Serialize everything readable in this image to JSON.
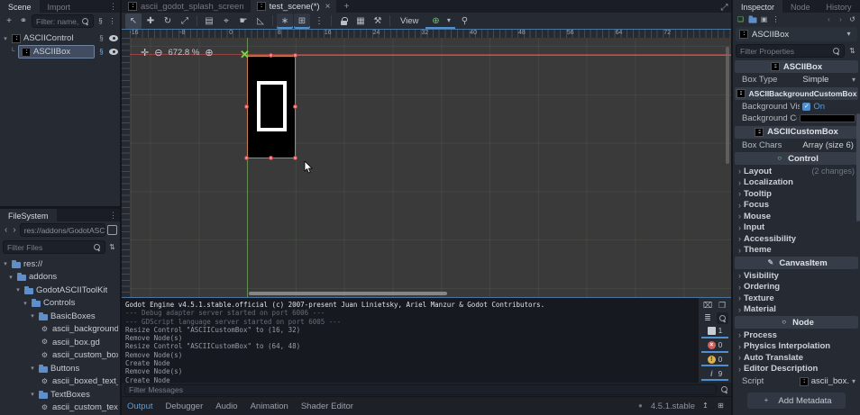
{
  "icons": {
    "plus": "+",
    "chain": "⚭",
    "kebab": "⋮",
    "check": "✓",
    "select": "↖",
    "move": "✚",
    "rotate": "↻",
    "scale": "⤢",
    "list_select": "▤",
    "pivot": "⌖",
    "pan": "☛",
    "ruler": "◺",
    "smart_snap": "∗",
    "grid_snap": "⊞",
    "group": "▦",
    "skeleton": "⚒",
    "chevron_down": "▾",
    "back": "‹",
    "fwd": "›",
    "close": "×",
    "center_view": "✛",
    "zoom_out": "⊖",
    "zoom_in": "⊕",
    "camera": "⊕",
    "mic": "⚲",
    "new_res": "❏",
    "save": "▣",
    "history": "↺",
    "sort": "⇅",
    "clear": "⌧",
    "copy": "❐",
    "collapse": "≣",
    "expand": "⤢",
    "update": "●",
    "pin": "↥",
    "float": "⊞",
    "gear": "⚙",
    "ascii_node": "::",
    "control": "○",
    "canvasitem": "✎",
    "node": "○",
    "script": "§",
    "expand_all": "᎒",
    "tree_arrow_open": "▾",
    "tree_arrow_closed": "›",
    "info": "i"
  },
  "scene_dock": {
    "tab_scene": "Scene",
    "tab_import": "Import",
    "filter_placeholder": "Filter: name, t:t",
    "tree": [
      {
        "label": "ASCIIControl"
      },
      {
        "label": "ASCIIBox"
      }
    ]
  },
  "filesystem": {
    "title": "FileSystem",
    "path": "res://addons/GodotASCIIT",
    "filter_placeholder": "Filter Files",
    "tree": [
      {
        "label": "res://"
      },
      {
        "label": "addons"
      },
      {
        "label": "GodotASCIIToolKit"
      },
      {
        "label": "Controls"
      },
      {
        "label": "BasicBoxes"
      },
      {
        "label": "ascii_background_c..."
      },
      {
        "label": "ascii_box.gd"
      },
      {
        "label": "ascii_custom_box.gd"
      },
      {
        "label": "Buttons"
      },
      {
        "label": "ascii_boxed_text_bu..."
      },
      {
        "label": "TextBoxes"
      },
      {
        "label": "ascii_custom_text_b..."
      }
    ]
  },
  "scene_tabs": {
    "tab1": "ascii_godot_splash_screen",
    "tab2": "test_scene(*)"
  },
  "toolbar": {
    "view_label": "View"
  },
  "canvas": {
    "zoom_level": "672.8 %",
    "ruler_top": [
      "-16",
      "-8",
      "0",
      "8",
      "16",
      "24",
      "32",
      "40",
      "48",
      "56",
      "64",
      "72"
    ],
    "ruler_left": [
      "0",
      "8",
      "16",
      "24",
      "32"
    ]
  },
  "output": {
    "lines": [
      {
        "text": "Godot Engine v4.5.1.stable.official (c) 2007-present Juan Linietsky, Ariel Manzur & Godot Contributors.",
        "type": "bright"
      },
      {
        "text": "--- Debug adapter server started on port 6006 ---",
        "type": "dimline"
      },
      {
        "text": "--- GDScript language server started on port 6005 ---",
        "type": "dimline"
      },
      {
        "text": "Resize Control \"ASCIICustomBox\" to (16, 32)",
        "type": ""
      },
      {
        "text": "Remove Node(s)",
        "type": ""
      },
      {
        "text": "Resize Control \"ASCIICustomBox\" to (64, 48)",
        "type": ""
      },
      {
        "text": "Remove Node(s)",
        "type": ""
      },
      {
        "text": "Create Node",
        "type": ""
      },
      {
        "text": "Remove Node(s)",
        "type": ""
      },
      {
        "text": "Create Node",
        "type": ""
      }
    ],
    "filter_placeholder": "Filter Messages",
    "counts": {
      "messages": "1",
      "errors": "0",
      "warnings": "0",
      "info": "9"
    },
    "tabs": {
      "output": "Output",
      "debugger": "Debugger",
      "audio": "Audio",
      "animation": "Animation",
      "shader": "Shader Editor"
    },
    "version": "4.5.1.stable"
  },
  "inspector": {
    "tab_inspector": "Inspector",
    "tab_node": "Node",
    "tab_history": "History",
    "object_name": "ASCIIBox",
    "filter_placeholder": "Filter Properties",
    "header_asciibox": "ASCIIBox",
    "header_background": "ASCIIBackgroundCustomBox",
    "header_custombox": "ASCIICustomBox",
    "header_control": "Control",
    "header_canvasitem": "CanvasItem",
    "header_node": "Node",
    "props": {
      "box_type_label": "Box Type",
      "box_type_value": "Simple",
      "bg_visible_label": "Background Visib",
      "bg_visible_value": "On",
      "bg_color_label": "Background Colo",
      "box_chars_label": "Box Chars",
      "box_chars_value": "Array (size 6)",
      "script_label": "Script",
      "script_value": "ascii_box."
    },
    "groups_control": [
      {
        "label": "Layout",
        "note": "(2 changes)"
      },
      {
        "label": "Localization",
        "note": ""
      },
      {
        "label": "Tooltip",
        "note": ""
      },
      {
        "label": "Focus",
        "note": ""
      },
      {
        "label": "Mouse",
        "note": ""
      },
      {
        "label": "Input",
        "note": ""
      },
      {
        "label": "Accessibility",
        "note": ""
      },
      {
        "label": "Theme",
        "note": ""
      }
    ],
    "groups_canvasitem": [
      {
        "label": "Visibility",
        "note": ""
      },
      {
        "label": "Ordering",
        "note": ""
      },
      {
        "label": "Texture",
        "note": ""
      },
      {
        "label": "Material",
        "note": ""
      }
    ],
    "groups_node": [
      {
        "label": "Process",
        "note": ""
      },
      {
        "label": "Physics Interpolation",
        "note": ""
      },
      {
        "label": "Auto Translate",
        "note": ""
      },
      {
        "label": "Editor Description",
        "note": ""
      }
    ],
    "add_metadata_label": "Add Metadata"
  },
  "colors": {
    "accent": "#4f8fce",
    "selection_border": "#c87d4e",
    "handle": "#ff8d8d",
    "gizmo": "#7ed44a"
  }
}
